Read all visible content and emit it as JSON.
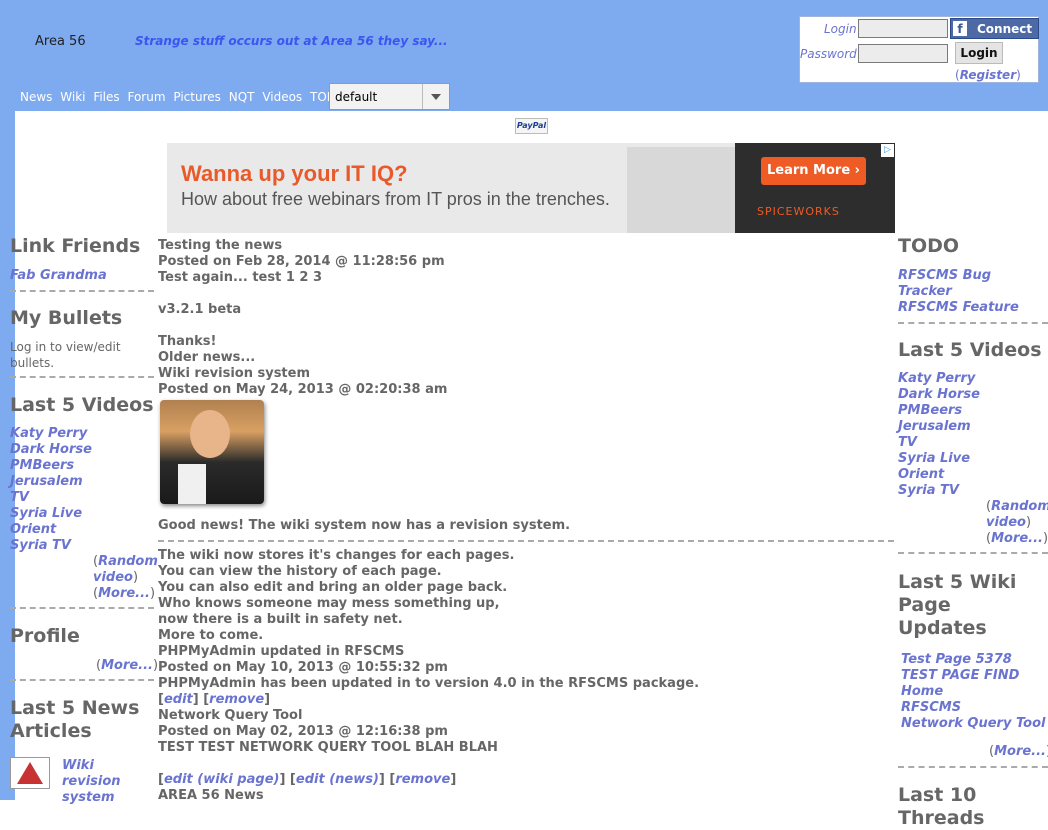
{
  "header": {
    "site_name": "Area 56",
    "tagline": "Strange stuff occurs out at Area 56 they say...",
    "login_label": "Login",
    "password_label": "Password",
    "fb_connect_label": "Connect",
    "login_button": "Login",
    "register_link": "Register",
    "theme_value": "default"
  },
  "nav": {
    "items": [
      "News",
      "Wiki",
      "Files",
      "Forum",
      "Pictures",
      "NQT",
      "Videos",
      "TODO"
    ]
  },
  "paypal_label": "PayPal",
  "ad": {
    "headline": "Wanna up your IT IQ?",
    "subline": "How about free webinars from IT pros in the trenches.",
    "cta": "Learn More",
    "brand": "SPICEWORKS"
  },
  "left": {
    "link_friends_title": "Link Friends",
    "link_friends": [
      "Fab Grandma"
    ],
    "bullets_title": "My Bullets",
    "bullets_text": "Log in to view/edit bullets.",
    "videos_title": "Last 5 Videos",
    "videos": [
      "Katy Perry",
      "Dark Horse",
      "PMBeers",
      "Jerusalem",
      "TV",
      "Syria Live",
      "Orient",
      "Syria TV"
    ],
    "random_video": "Random video",
    "more": "More...",
    "profile_title": "Profile",
    "profile_more": "More...",
    "news_title": "Last 5 News Articles",
    "news_item": "Wiki revision system"
  },
  "right": {
    "todo_title": "TODO",
    "todo_items": [
      "RFSCMS Bug Tracker",
      "RFSCMS Feature"
    ],
    "videos_title": "Last 5 Videos",
    "videos": [
      "Katy Perry",
      "Dark Horse",
      "PMBeers",
      "Jerusalem",
      "TV",
      "Syria Live",
      "Orient",
      "Syria TV"
    ],
    "random_video": "Random video",
    "more": "More...",
    "wiki_title": "Last 5 Wiki Page Updates",
    "wiki_items": [
      "Test Page 5378",
      "TEST PAGE FIND",
      "Home",
      "RFSCMS",
      "Network Query Tool"
    ],
    "wiki_more": "More...",
    "threads_title": "Last 10 Threads"
  },
  "main": {
    "n1_title": "Testing the news",
    "n1_date": "Posted on Feb 28, 2014 @ 11:28:56 pm",
    "n1_body1": "Test again... test 1 2 3",
    "n1_body2": "v3.2.1 beta",
    "n1_body3": "Thanks!",
    "older_news": "Older news...",
    "n2_title": "Wiki revision system",
    "n2_date": "Posted on May 24, 2013 @ 02:20:38 am",
    "n2_lead": "Good news! The wiki system now has a revision system.",
    "n2_lines": [
      "The wiki now stores it's changes for each pages.",
      "You can view the history of each page.",
      "You can also edit and bring an older page back.",
      "Who knows someone may mess something up,",
      "now there is a built in safety net.",
      "More to come."
    ],
    "n3_title": "PHPMyAdmin updated in RFSCMS",
    "n3_date": "Posted on May 10, 2013 @ 10:55:32 pm",
    "n3_body": "PHPMyAdmin has been updated in to version 4.0 in the RFSCMS package.",
    "edit": "edit",
    "remove": "remove",
    "n4_title": "Network Query Tool",
    "n4_date": "Posted on May 02, 2013 @ 12:16:38 pm",
    "n4_body": "TEST TEST NETWORK QUERY TOOL BLAH BLAH",
    "edit_wiki": "edit (wiki page)",
    "edit_news": "edit (news)",
    "n5_title": "AREA 56 News"
  }
}
